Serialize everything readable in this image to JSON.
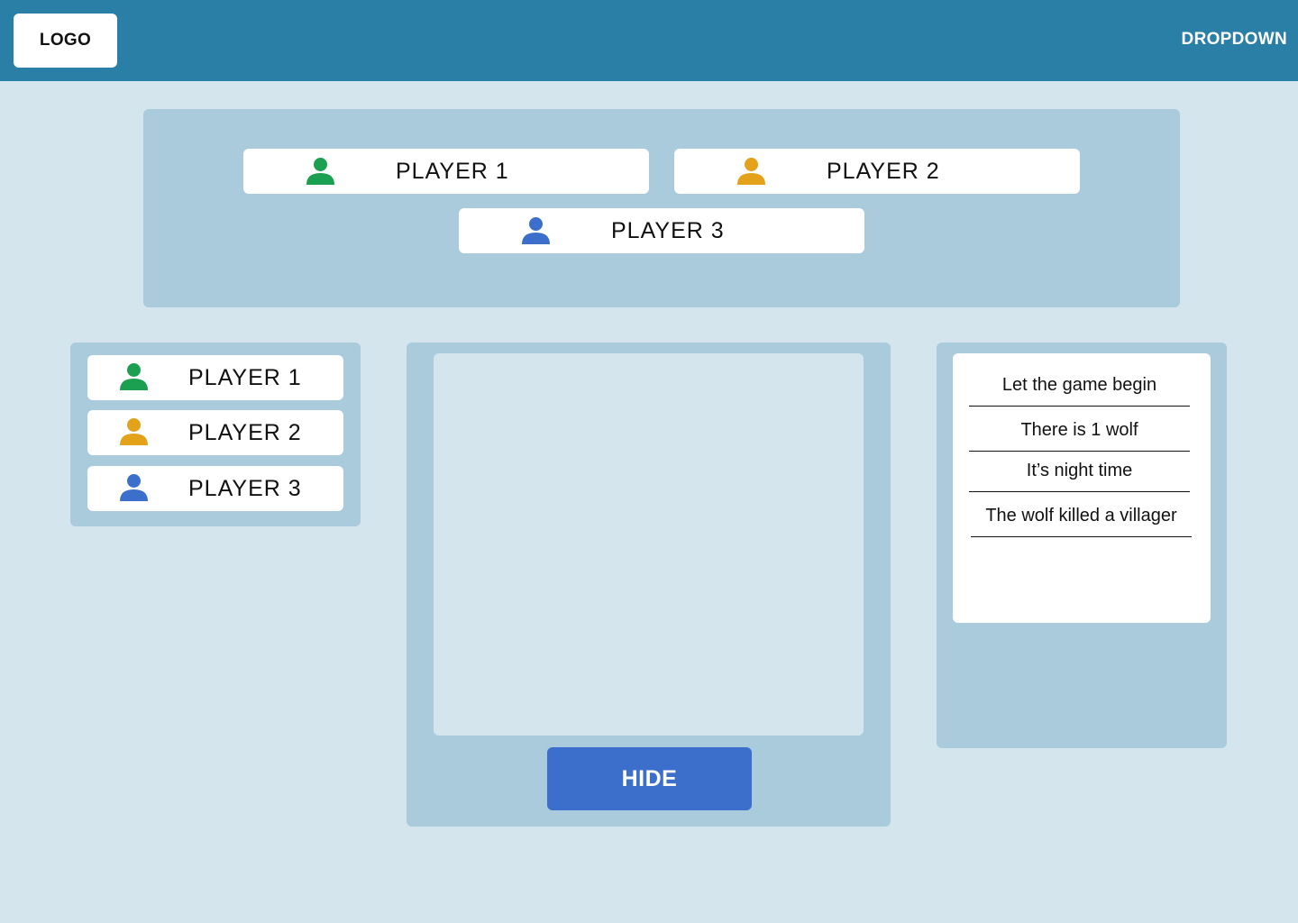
{
  "header": {
    "logo": "LOGO",
    "dropdown": "DROPDOWN"
  },
  "players": [
    {
      "name": "PLAYER 1",
      "icon": "user-icon",
      "color": "#1aa050"
    },
    {
      "name": "PLAYER 2",
      "icon": "user-icon",
      "color": "#e3a21a"
    },
    {
      "name": "PLAYER 3",
      "icon": "user-icon",
      "color": "#3b6fcb"
    }
  ],
  "game": {
    "hide_label": "HIDE"
  },
  "log": {
    "lines": [
      "Let the game begin",
      "There is 1 wolf",
      "It’s night time",
      "The wolf killed a villager"
    ]
  },
  "colors": {
    "header": "#2a7fa6",
    "background": "#d4e5ed",
    "panel": "#aacbdb",
    "button": "#3b6fcb"
  }
}
